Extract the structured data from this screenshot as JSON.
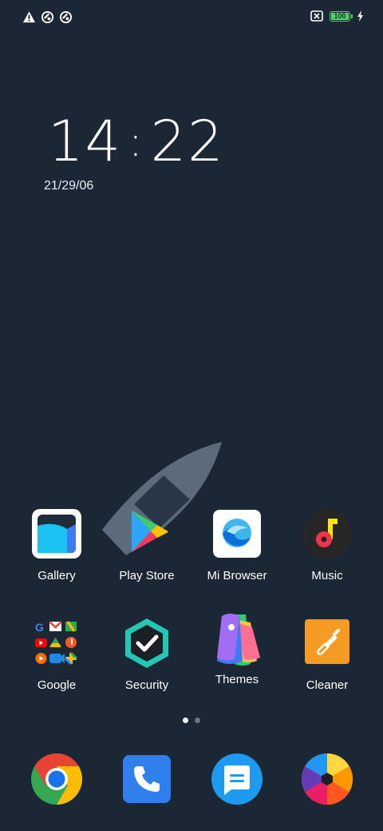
{
  "clock": {
    "hours": "14",
    "separator": ":",
    "minutes": "22",
    "date": "21/29/06"
  },
  "status": {
    "battery_level": "100",
    "icons": [
      "warning-icon",
      "do-not-disturb-icon",
      "data-saver-icon",
      "sim-off-icon",
      "battery-icon",
      "charging-bolt-icon"
    ]
  },
  "apps_row1": [
    {
      "label": "Gallery",
      "icon": "gallery-icon"
    },
    {
      "label": "Play Store",
      "icon": "play-store-icon"
    },
    {
      "label": "Mi Browser",
      "icon": "mi-browser-icon"
    },
    {
      "label": "Music",
      "icon": "music-icon"
    }
  ],
  "apps_row2": [
    {
      "label": "Google",
      "icon": "google-folder-icon"
    },
    {
      "label": "Security",
      "icon": "security-icon"
    },
    {
      "label": "Themes",
      "icon": "themes-icon"
    },
    {
      "label": "Cleaner",
      "icon": "cleaner-icon"
    }
  ],
  "dock": [
    {
      "name": "Chrome",
      "icon": "chrome-icon"
    },
    {
      "name": "Phone",
      "icon": "phone-icon"
    },
    {
      "name": "Messages",
      "icon": "messages-icon"
    },
    {
      "name": "Camera",
      "icon": "camera-icon"
    }
  ],
  "pages": {
    "count": 2,
    "current": 1
  },
  "colors": {
    "background": "#1c2735",
    "battery_green": "#4cd964"
  }
}
